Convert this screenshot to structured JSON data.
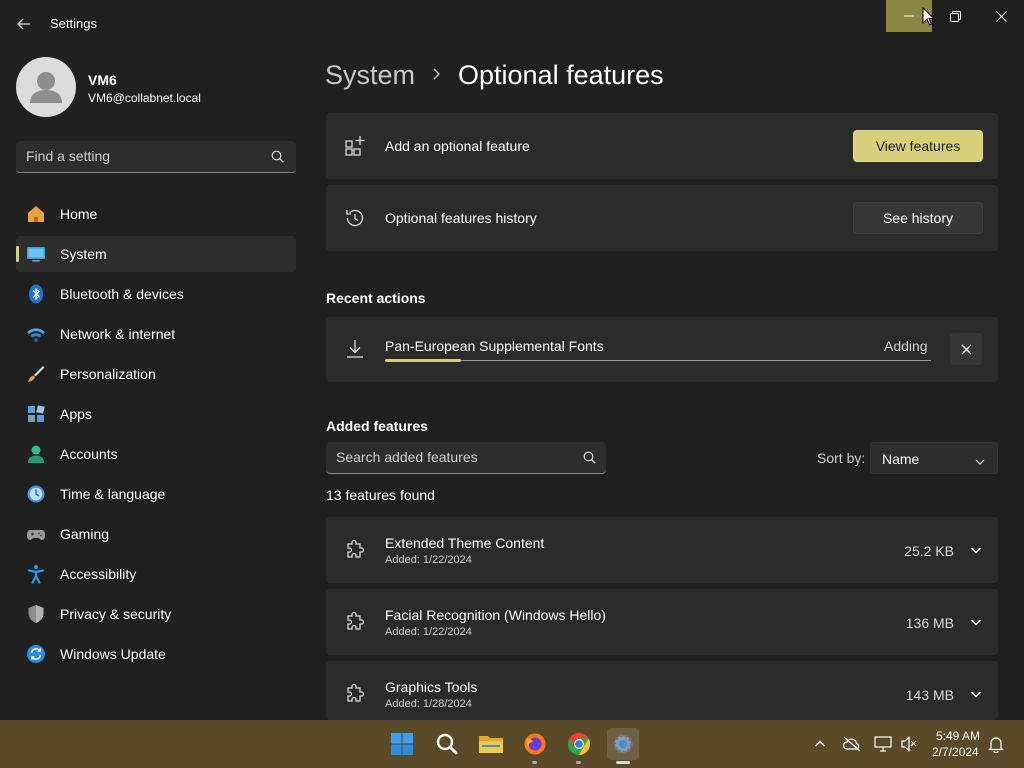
{
  "window": {
    "title": "Settings",
    "accent_color": "#d6d07a"
  },
  "user": {
    "name": "VM6",
    "email": "VM6@collabnet.local"
  },
  "sidebar": {
    "search_placeholder": "Find a setting",
    "items": [
      {
        "label": "Home",
        "icon": "home-icon",
        "active": false
      },
      {
        "label": "System",
        "icon": "monitor-icon",
        "active": true
      },
      {
        "label": "Bluetooth & devices",
        "icon": "bluetooth-icon",
        "active": false
      },
      {
        "label": "Network & internet",
        "icon": "wifi-icon",
        "active": false
      },
      {
        "label": "Personalization",
        "icon": "brush-icon",
        "active": false
      },
      {
        "label": "Apps",
        "icon": "apps-icon",
        "active": false
      },
      {
        "label": "Accounts",
        "icon": "person-icon",
        "active": false
      },
      {
        "label": "Time & language",
        "icon": "clock-globe-icon",
        "active": false
      },
      {
        "label": "Gaming",
        "icon": "gamepad-icon",
        "active": false
      },
      {
        "label": "Accessibility",
        "icon": "accessibility-icon",
        "active": false
      },
      {
        "label": "Privacy & security",
        "icon": "shield-icon",
        "active": false
      },
      {
        "label": "Windows Update",
        "icon": "update-icon",
        "active": false
      }
    ]
  },
  "header": {
    "breadcrumb_parent": "System",
    "breadcrumb_separator": "›",
    "page_title": "Optional features"
  },
  "add_feature": {
    "label": "Add an optional feature",
    "button": "View features"
  },
  "history": {
    "label": "Optional features history",
    "button": "See history"
  },
  "recent": {
    "section_title": "Recent actions",
    "item": {
      "name": "Pan-European Supplemental Fonts",
      "status": "Adding",
      "progress_fraction": 0.14
    }
  },
  "added": {
    "section_title": "Added features",
    "search_placeholder": "Search added features",
    "sort_label": "Sort by:",
    "sort_value": "Name",
    "count_text": "13 features found",
    "features": [
      {
        "name": "Extended Theme Content",
        "date": "Added: 1/22/2024",
        "size": "25.2 KB"
      },
      {
        "name": "Facial Recognition (Windows Hello)",
        "date": "Added: 1/22/2024",
        "size": "136 MB"
      },
      {
        "name": "Graphics Tools",
        "date": "Added: 1/28/2024",
        "size": "143 MB"
      }
    ]
  },
  "taskbar": {
    "time": "5:49 AM",
    "date": "2/7/2024"
  }
}
